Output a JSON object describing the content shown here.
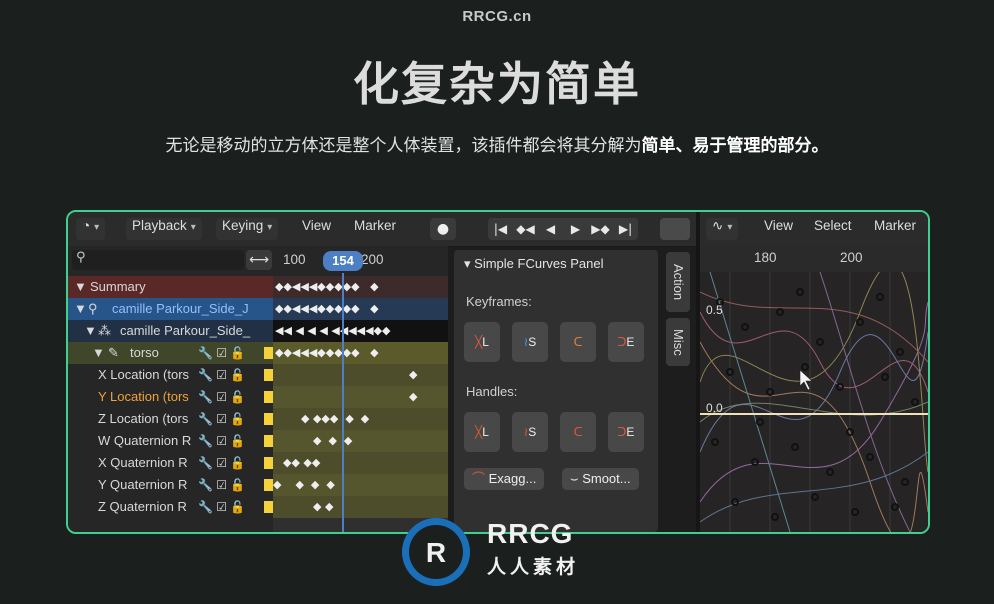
{
  "site": "RRCG.cn",
  "headline": "化复杂为简单",
  "subtitle_plain": "无论是移动的立方体还是整个人体装置，该插件都会将其分解为",
  "subtitle_bold": "简单、易于管理的部分。",
  "toolbar": {
    "playback": "Playback",
    "keying": "Keying",
    "view": "View",
    "marker": "Marker"
  },
  "ruler": {
    "t100": "100",
    "current": "154",
    "t200": "200"
  },
  "channels": [
    {
      "label": "Summary"
    },
    {
      "label": "camille Parkour_Side_J"
    },
    {
      "label": "camille Parkour_Side_"
    },
    {
      "label": "torso"
    },
    {
      "label": "X Location (tors"
    },
    {
      "label": "Y Location (tors"
    },
    {
      "label": "Z Location (tors"
    },
    {
      "label": "W Quaternion R"
    },
    {
      "label": "X Quaternion R"
    },
    {
      "label": "Y Quaternion R"
    },
    {
      "label": "Z Quaternion R"
    }
  ],
  "panel": {
    "title": "Simple FCurves Panel",
    "keyframes": "Keyframes:",
    "handles": "Handles:",
    "btn_l": "L",
    "btn_s": "S",
    "btn_e": "E",
    "exagg": "Exagg...",
    "smoot": "Smoot..."
  },
  "tabs": {
    "action": "Action",
    "misc": "Misc"
  },
  "graph": {
    "view": "View",
    "select": "Select",
    "marker": "Marker",
    "t180": "180",
    "t200": "200",
    "y05": "0.5",
    "y00": "0.0"
  },
  "logo": {
    "main": "RRCG",
    "sub": "人人素材"
  },
  "colors": {
    "accent_border": "#3fcf8e",
    "frame_blue": "#4d7fc4",
    "channel_yellow": "#f5d23a"
  }
}
